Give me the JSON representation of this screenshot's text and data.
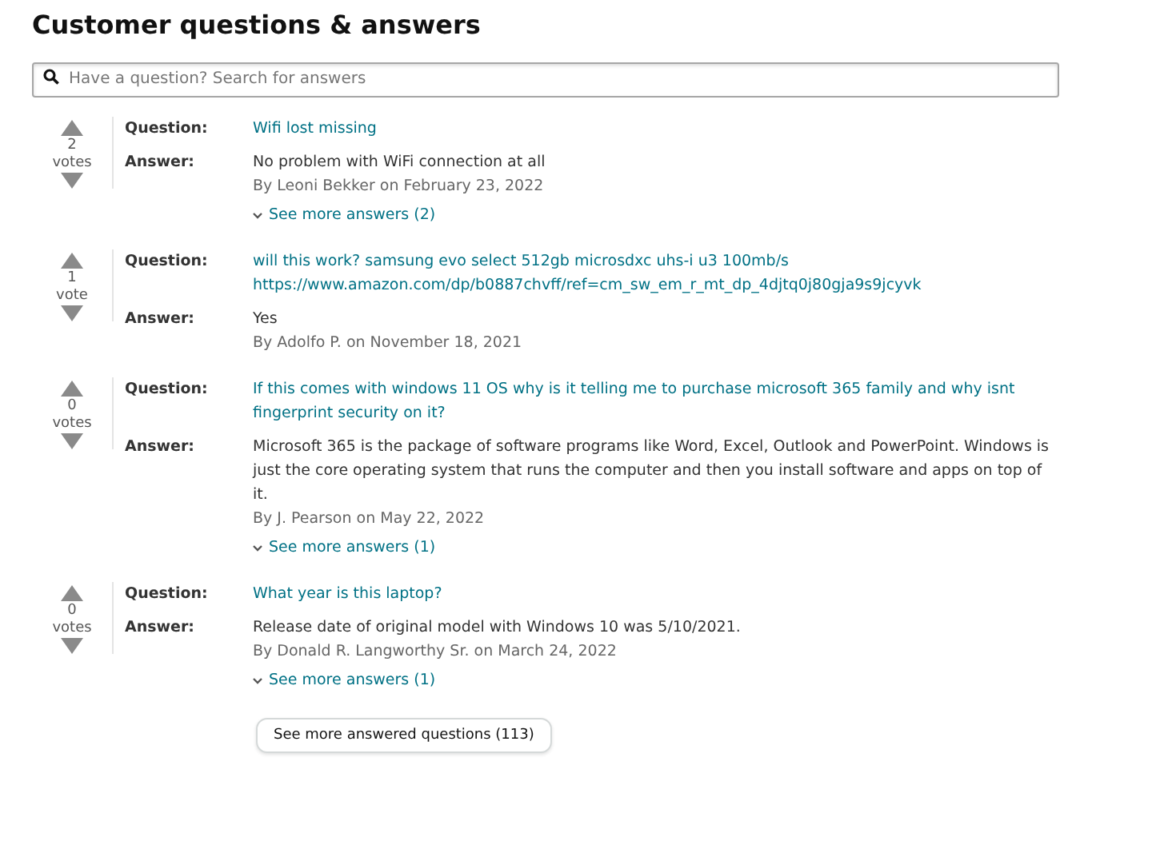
{
  "title": "Customer questions & answers",
  "search": {
    "placeholder": "Have a question? Search for answers"
  },
  "questions": [
    {
      "votes": "2",
      "votes_label": "votes",
      "question_label": "Question:",
      "question": "Wifi lost missing",
      "answer_label": "Answer:",
      "answer": "No problem with WiFi connection at all",
      "byline": "By Leoni Bekker on February 23, 2022",
      "more": "See more answers (2)"
    },
    {
      "votes": "1",
      "votes_label": "vote",
      "question_label": "Question:",
      "question": "will this work? samsung evo select 512gb microsdxc uhs-i u3 100mb/s https://www.amazon.com/dp/b0887chvff/ref=cm_sw_em_r_mt_dp_4djtq0j80gja9s9jcyvk",
      "answer_label": "Answer:",
      "answer": "Yes",
      "byline": "By Adolfo P. on November 18, 2021"
    },
    {
      "votes": "0",
      "votes_label": "votes",
      "question_label": "Question:",
      "question": "If this comes with windows 11 OS why is it telling me to purchase microsoft 365 family and why isnt fingerprint security on it?",
      "answer_label": "Answer:",
      "answer": "Microsoft 365 is the package of software programs like Word, Excel, Outlook and PowerPoint. Windows is just the core operating system that runs the computer and then you install software and apps on top of it.",
      "byline": "By J. Pearson on May 22, 2022",
      "more": "See more answers (1)"
    },
    {
      "votes": "0",
      "votes_label": "votes",
      "question_label": "Question:",
      "question": "What year is this laptop?",
      "answer_label": "Answer:",
      "answer": "Release date of original model with Windows 10 was 5/10/2021.",
      "byline": "By Donald R. Langworthy Sr. on March 24, 2022",
      "more": "See more answers (1)"
    }
  ],
  "more_button": "See more answered questions (113)"
}
